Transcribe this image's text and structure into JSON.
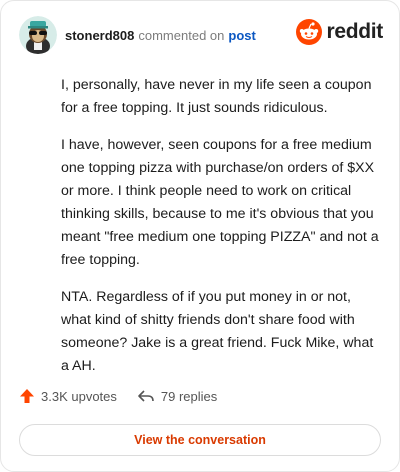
{
  "comment": {
    "username": "stonerd808",
    "action": "commented on",
    "post_link": "post",
    "paragraphs": [
      "I, personally, have never in my life seen a coupon for a free topping. It just sounds ridiculous.",
      "I have, however, seen coupons for a free medium one topping pizza with purchase/on orders of $XX or more. I think people need to work on critical thinking skills, because to me it's obvious that you meant \"free medium one topping PIZZA\" and not a free topping.",
      "NTA. Regardless of if you put money in or not, what kind of shitty friends don't share food with someone? Jake is a great friend. Fuck Mike, what a AH."
    ]
  },
  "brand": {
    "name": "reddit",
    "icon": "reddit-logo-icon",
    "color": "#ff4500"
  },
  "stats": {
    "upvotes": "3.3K upvotes",
    "upvote_icon": "upvote-arrow-icon",
    "replies": "79 replies",
    "reply_icon": "reply-arrow-icon"
  },
  "cta": {
    "label": "View the conversation",
    "color": "#d93a00"
  }
}
